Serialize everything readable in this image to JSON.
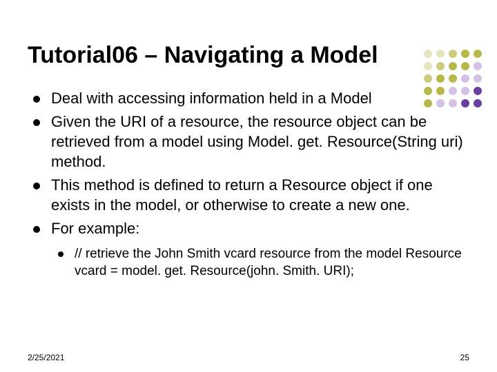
{
  "title": "Tutorial06 – Navigating a Model",
  "bullets": [
    "Deal with accessing information held in a Model",
    "Given the URI of a resource, the resource object can be retrieved from a model using Model. get. Resource(String uri) method.",
    "This method is defined to return a Resource object if one exists in the model, or otherwise to create a new one.",
    "For example:"
  ],
  "sub": [
    "// retrieve the John Smith vcard resource from the model Resource vcard = model. get. Resource(john. Smith. URI);"
  ],
  "footer": {
    "date": "2/25/2021",
    "page": "25"
  },
  "decor_colors": {
    "olive": "#b8b84a",
    "olive_mid": "#cccc7a",
    "olive_light": "#e5e5bf",
    "purple": "#6b3fa0",
    "purple_light": "#d3c2e5"
  }
}
